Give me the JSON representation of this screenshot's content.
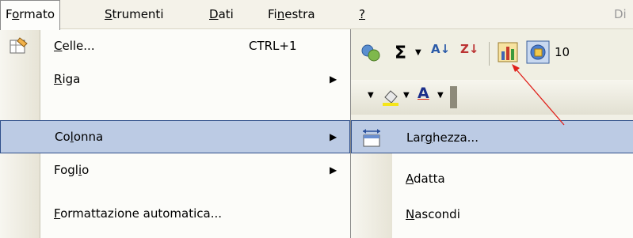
{
  "menubar": {
    "items": [
      {
        "pre": "F",
        "ul": "o",
        "post": "rmato"
      },
      {
        "pre": "",
        "ul": "S",
        "post": "trumenti"
      },
      {
        "pre": "",
        "ul": "D",
        "post": "ati"
      },
      {
        "pre": "Fi",
        "ul": "n",
        "post": "estra"
      },
      {
        "pre": "",
        "ul": "?",
        "post": ""
      }
    ],
    "hint": "Di"
  },
  "toolbar": {
    "sigma": "Σ",
    "sort_az": "A↓",
    "sort_za": "Z↓",
    "zoom": "10",
    "font_color_letter": "A"
  },
  "format_menu": {
    "items": [
      {
        "pre": "",
        "ul": "C",
        "post": "elle...",
        "shortcut": "CTRL+1",
        "submenu": false
      },
      {
        "pre": "",
        "ul": "R",
        "post": "iga",
        "shortcut": "",
        "submenu": true
      },
      {
        "pre": "Co",
        "ul": "l",
        "post": "onna",
        "shortcut": "",
        "submenu": true
      },
      {
        "pre": "Fogl",
        "ul": "i",
        "post": "o",
        "shortcut": "",
        "submenu": true
      },
      {
        "pre": "",
        "ul": "F",
        "post": "ormattazione automatica...",
        "shortcut": "",
        "submenu": false
      }
    ],
    "submenu_arrow": "▶"
  },
  "column_submenu": {
    "items": [
      {
        "pre": "Lar",
        "ul": "g",
        "post": "hezza..."
      },
      {
        "pre": "",
        "ul": "A",
        "post": "datta"
      },
      {
        "pre": "",
        "ul": "N",
        "post": "ascondi"
      }
    ]
  },
  "colors": {
    "highlight": "#bccbe4",
    "highlight_border": "#2f4f8a",
    "annotation_arrow": "#e0201a"
  }
}
